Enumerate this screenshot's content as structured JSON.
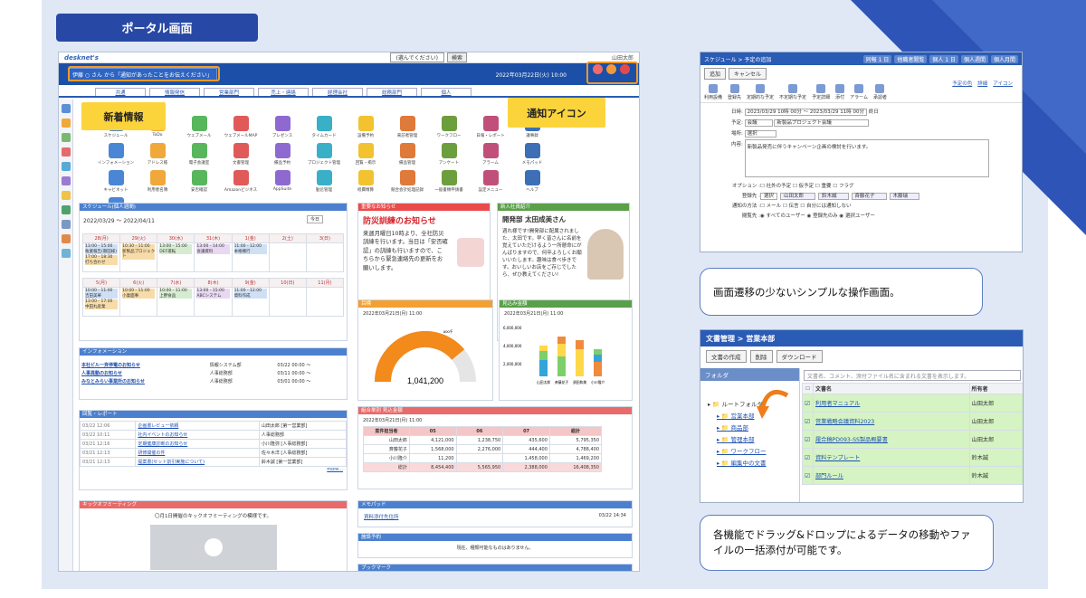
{
  "page_title": "ポータル画面",
  "portal": {
    "search_select": "(選んでください)",
    "search_button": "検索",
    "user_name": "山田太郎",
    "news_text": "伊藤 ○ さん から「通知があったことをお伝えください」",
    "date_time": "2022年03月22日(火) 10:00",
    "tabs": [
      "共通",
      "情報発信",
      "営業部門",
      "売上・連絡",
      "経理会社",
      "総務部門",
      "個人"
    ],
    "apps": [
      "スケジュール",
      "ToDo",
      "ウェブメール",
      "ウェブメールMAP",
      "プレゼンス",
      "タイムカード",
      "設備予約",
      "来訪者管理",
      "ワークフロー",
      "日報・レポート",
      "議事録",
      "インフォメーション",
      "アドレス帳",
      "電子会議室",
      "文書管理",
      "備品予約",
      "プロジェクト管理",
      "回覧・掲示",
      "備品管理",
      "アンケート",
      "アラーム",
      "メモパッド",
      "キャビネット",
      "利用者名簿",
      "安否確認",
      "Amazonビジネス",
      "AppSuite",
      "勤怠管理",
      "経費精算",
      "競合会計処理記録",
      "一般書類申請書",
      "設定メニュー",
      "ヘルプ",
      "ポータル設定"
    ],
    "schedule": {
      "title": "スケジュール(個人週間)",
      "range": "2022/03/29 〜 2022/04/11",
      "today": "今日",
      "week1_days": [
        "28(月)",
        "29(火)",
        "30(水)",
        "31(木)",
        "1(金)",
        "2(土)",
        "3(日)"
      ],
      "week1_events": [
        "13:00 - 15:00 執業報告(御田様)",
        "10:30 - 11:00 新製品プロジェクト",
        "13:00 - 15:00 DEF運転",
        "13:00 - 14:00 会議資料",
        "11:00 - 12:00 本格棚行",
        "16:30 - 17:30 小業務等",
        "12:00 - 13:00 自業管能力",
        "17:00 - 18:30 打ち合わせ"
      ],
      "week2_days": [
        "5(月)",
        "6(火)",
        "7(水)",
        "8(木)",
        "9(金)",
        "10(日)",
        "11(月)"
      ],
      "week2_events": [
        "10:00 - 11:00 吉田美華",
        "10:00 - 11:00 小妻面事",
        "10:00 - 11:00 上野食品",
        "13:00 - 15:00 ABCシステム",
        "11:00 - 12:00 資料作成",
        "16:00 - 17:00 資料レビュー",
        "14:00 - 16:00 山中産業",
        "13:00 - 17:00 中田丸産業"
      ]
    },
    "notice": {
      "header": "重要なお知らせ",
      "title": "防災訓練のお知らせ",
      "body": "来週月曜日10時より、全社防災訓練を行います。当日は「安否確認」の訓練も行いますので、こちらから緊急連絡先の更新をお願いします。",
      "link": "こちら"
    },
    "staff": {
      "header": "新入社員紹介",
      "name": "開発部 太田成美さん",
      "body": "週れ様です!開発部に配属されました、太田です。早く皆さんに名前を覚えていただけるよう一所懸命にがんばりますので、何卒よろしくお願いいたします。趣味は食べ歩きです。おいしいお店をご存じでしたら、ぜひ教えてください!"
    },
    "gauge": {
      "header": "目標",
      "date": "2022年03月21日(月) 11:00",
      "value": "1,041,200",
      "max_label": "800千",
      "ratio": 0.78
    },
    "bars": {
      "header": "見込み金額",
      "date": "2022年03月21日(月) 11:00",
      "y_ticks": [
        "6,000,000",
        "4,000,000",
        "2,000,000"
      ],
      "x_labels": [
        "山田太郎",
        "斉藤花子",
        "須田和美",
        "小川隆介"
      ]
    },
    "info": {
      "header": "インフォメーション",
      "rows": [
        [
          "本社ビル一斉停電のお知らせ",
          "情報システム部",
          "03/22 00:00 〜"
        ],
        [
          "人事異動のお知らせ",
          "人事総務部",
          "03/11 00:00 〜"
        ],
        [
          "みなとみらい事業所のお知らせ",
          "人事総務部",
          "03/01 00:00 〜"
        ]
      ]
    },
    "circular": {
      "header": "回覧・レポート",
      "rows": [
        [
          "03/22 12:06",
          "企画書レビュー依頼",
          "山田太郎 [第一営業部]"
        ],
        [
          "03/22 10:11",
          "社内イベントのお知らせ",
          "人事総務部"
        ],
        [
          "03/21 12:16",
          "定期健康診断のお知らせ",
          "小川隆弥 [人事総務部]"
        ],
        [
          "03/21 12:13",
          "研修開催の件",
          "佐々木洋 [人事総務部]"
        ],
        [
          "03/21 12:13",
          "提案書(セット割引実施について)",
          "鈴木誠 [第一営業部]"
        ]
      ],
      "more": "more..."
    },
    "sales": {
      "header": "組合単別 見込金額",
      "date": "2022年03月21日(月) 11:00",
      "col_header": "売上見込月",
      "row_header": "案件担当者",
      "months": [
        "05",
        "06",
        "07",
        "総計"
      ],
      "rows": [
        [
          "山田太郎",
          "4,121,000",
          "1,238,750",
          "435,600",
          "5,795,350"
        ],
        [
          "斉藤花子",
          "1,568,000",
          "2,276,000",
          "444,400",
          "4,788,400"
        ],
        [
          "小川隆介",
          "11,200",
          "",
          "1,458,000",
          "1,469,200"
        ],
        [
          "総計",
          "8,454,400",
          "5,565,950",
          "2,388,000",
          "16,408,350"
        ]
      ]
    },
    "kickoff": {
      "header": "キックオフミーティング",
      "text": "〇月1日開催のキックオフミーティングの模様です。"
    },
    "memo": {
      "header": "メモパッド",
      "link": "資料添付先住所",
      "time": "03/22 14:34"
    },
    "facility": {
      "header": "施設予約",
      "text": "現在、種類可能なものはありません。"
    },
    "bookmark": {
      "header": "ブックマーク"
    }
  },
  "callouts": {
    "news": "新着情報",
    "notify": "通知アイコン"
  },
  "schedule_screen": {
    "title": "スケジュール > 予定の追加",
    "top_buttons": [
      "同報 1 日",
      "他職者閲覧",
      "個人 1 日",
      "個人週間",
      "個人月間"
    ],
    "actions": [
      "追加",
      "キャンセル"
    ],
    "toolbar": [
      "利用設備",
      "登録先",
      "定期的な予定",
      "不定期な予定",
      "予定詳細",
      "添付",
      "アラーム",
      "承認者"
    ],
    "labels": {
      "date": "日時",
      "plan": "予定",
      "place": "場所",
      "content": "内容",
      "option": "オプション",
      "registrant": "登録先",
      "notify": "通知の方法",
      "viewer": "閲覧先"
    },
    "date_value": "2023/03/29  10時 00分 〜 2023/03/29  11時 00分",
    "allday": "終日",
    "plan_type": "会議",
    "plan_title": "新製品プロジェクト会議",
    "place_value": "選択",
    "content_value": "新製品発売に伴うキャンペーン企画の検討を行います。",
    "options": [
      "社外の予定",
      "仮予定",
      "重要",
      "フラグ"
    ],
    "registrants": [
      "山田太郎",
      "鈴木誠",
      "斉藤花子",
      "木藤瑞"
    ],
    "select_btn": "選択",
    "notify_opts": [
      "メール",
      "伝言",
      "自分には通知しない"
    ],
    "viewer_opts": [
      "すべてのユーザー",
      "登録先のみ",
      "選択ユーザー"
    ],
    "links": [
      "予定の色",
      "詳細",
      "アイコン"
    ]
  },
  "bubble1": "画面遷移の少ないシンプルな操作画面。",
  "doc_screen": {
    "title": "文書管理 > 営業本部",
    "buttons": [
      "文書の作成",
      "削除",
      "ダウンロード"
    ],
    "folder_label": "フォルダ",
    "search_placeholder": "文書名、コメント、添付ファイル名に含まれる文書を表示します。",
    "col_doc": "文書名",
    "col_owner": "所有者",
    "folders": [
      "ルートフォルダ",
      "営業本部",
      "商品部",
      "管理本部",
      "ワークフロー",
      "編集中の文書"
    ],
    "docs": [
      [
        "利用者マニュアル",
        "山田太郎"
      ],
      [
        "営業戦略会議資料2023",
        "山田太郎"
      ],
      [
        "履合稿PD093-SS製品概要書",
        "山田太郎"
      ],
      [
        "資料テンプレート",
        "鈴木誠"
      ],
      [
        "部門ルール",
        "鈴木誠"
      ]
    ]
  },
  "bubble2": "各機能でドラッグ&ドロップによるデータの移動やファイルの一括添付が可能です。",
  "colors": {
    "brand": "#2848a6",
    "accent": "#f49a26",
    "callout": "#fbd43c",
    "header_blue": "#1c4fa7"
  }
}
